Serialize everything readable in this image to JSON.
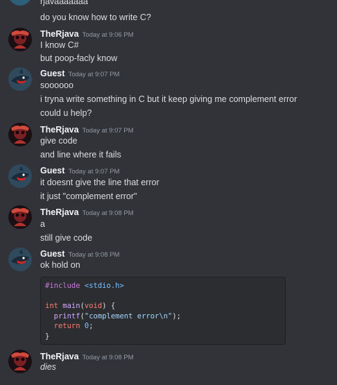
{
  "messages": {
    "top_partial": {
      "text": "rjavaaaaaaa",
      "line2": "do you know how to write C?"
    },
    "m1": {
      "user": "TheRjava",
      "time": "Today at 9:06 PM",
      "lines": [
        "I know C#",
        "but poop-facly know"
      ]
    },
    "m2": {
      "user": "Guest",
      "time": "Today at 9:07 PM",
      "lines": [
        "soooooo",
        "i tryna write something in C but it keep giving me complement error",
        "could u help?"
      ]
    },
    "m3": {
      "user": "TheRjava",
      "time": "Today at 9:07 PM",
      "lines": [
        "give code",
        "and line where it fails"
      ]
    },
    "m4": {
      "user": "Guest",
      "time": "Today at 9:07 PM",
      "lines": [
        "it doesnt give the line that error",
        "it just \"complement error\""
      ]
    },
    "m5": {
      "user": "TheRjava",
      "time": "Today at 9:08 PM",
      "lines": [
        "a",
        "still give code"
      ]
    },
    "m6": {
      "user": "Guest",
      "time": "Today at 9:08 PM",
      "lines": [
        "ok hold on"
      ]
    },
    "m7": {
      "user": "TheRjava",
      "time": "Today at 9:08 PM",
      "lines": [
        "dies"
      ]
    }
  },
  "code": {
    "include_kw": "#include",
    "include_hdr": " <stdio.h>",
    "l3_int": "int",
    "l3_main": " main",
    "l3_open": "(",
    "l3_void": "void",
    "l3_rest": ") {",
    "l4_printf": "  printf",
    "l4_open": "(",
    "l4_str": "\"complement error\\n\"",
    "l4_close": ");",
    "l5_return": "  return",
    "l5_sp": " ",
    "l5_zero": "0",
    "l5_semi": ";",
    "l6": "}"
  },
  "colors": {
    "background": "#313338",
    "username": "#f2f3f5",
    "timestamp": "#949ba4",
    "codeblock_bg": "#2b2d31"
  },
  "icons": {
    "therjava_avatar": "red-skull-avatar",
    "guest_avatar": "blue-shark-avatar"
  }
}
